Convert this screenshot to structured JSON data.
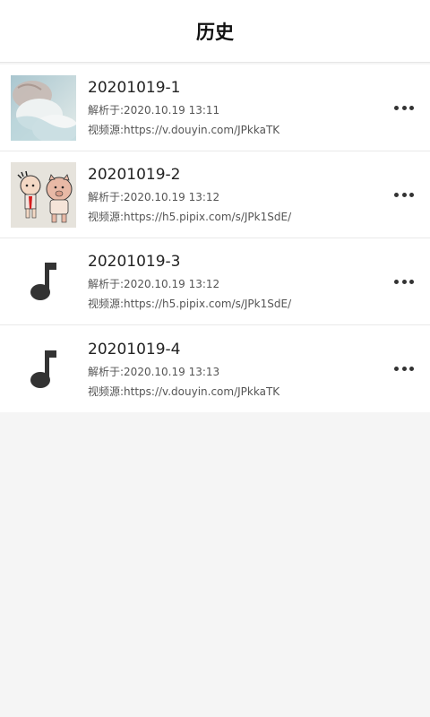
{
  "header": {
    "title": "历史"
  },
  "items": [
    {
      "title": "20201019-1",
      "parsed": "解析于:2020.10.19 13:11",
      "source": "视频源:https://v.douyin.com/JPkkaTK",
      "thumbnail": "baby-photo"
    },
    {
      "title": "20201019-2",
      "parsed": "解析于:2020.10.19 13:12",
      "source": "视频源:https://h5.pipix.com/s/JPk1SdE/",
      "thumbnail": "cartoon-pig"
    },
    {
      "title": "20201019-3",
      "parsed": "解析于:2020.10.19 13:12",
      "source": "视频源:https://h5.pipix.com/s/JPk1SdE/",
      "thumbnail": "music-note-icon"
    },
    {
      "title": "20201019-4",
      "parsed": "解析于:2020.10.19 13:13",
      "source": "视频源:https://v.douyin.com/JPkkaTK",
      "thumbnail": "music-note-icon"
    }
  ],
  "colors": {
    "background": "#f5f5f5",
    "card": "#ffffff",
    "title_text": "#222222",
    "meta_text": "#555555",
    "icon": "#333333"
  }
}
